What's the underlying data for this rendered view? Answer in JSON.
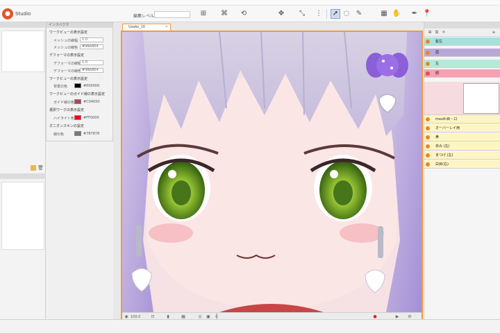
{
  "app": {
    "name": "Studio",
    "edit_level_label": "編集レベル"
  },
  "toolbar": {
    "icons": [
      "undo-icon",
      "redo-icon",
      "deform-icon",
      "warp-icon",
      "rotate-icon",
      "move-icon",
      "select-arrow-icon",
      "lasso-icon",
      "brush-icon",
      "eyedropper-icon",
      "pin-icon"
    ]
  },
  "properties": {
    "header": "インスペクタ",
    "sections": [
      {
        "title": "ワークビューの表示設定",
        "rows": [
          {
            "label": "メッシュの線幅",
            "value": "1.0"
          },
          {
            "label": "メッシュの線色",
            "value": "#9BA8E4"
          }
        ]
      },
      {
        "title": "デフォーマの表示設定",
        "rows": [
          {
            "label": "デフォーマの線幅",
            "value": "1.0"
          },
          {
            "label": "デフォーマの線色",
            "value": "#9BA8E4"
          }
        ]
      },
      {
        "title": "ワークビューの表示設定",
        "rows": [
          {
            "label": "背景の色",
            "value": "#000000",
            "swatch": "#000000"
          }
        ]
      },
      {
        "title": "ワークビューのガイド線の表示設定",
        "rows": [
          {
            "label": "ガイド線の色",
            "value": "#C04050",
            "swatch": "#c04050"
          }
        ]
      },
      {
        "title": "選択ワークの表示設定",
        "rows": [
          {
            "label": "ハイライト色",
            "value": "#FF0000",
            "swatch": "#ff0000"
          }
        ]
      },
      {
        "title": "オニオンスキンの設定",
        "rows": [
          {
            "label": "線の色",
            "value": "#787878",
            "swatch": "#787878"
          }
        ]
      }
    ]
  },
  "view": {
    "tab_label": "Usako_10",
    "zoom": "100.0",
    "status_icons": [
      "camera-icon",
      "fit-icon",
      "grid-icon",
      "ruler-icon",
      "onion-icon",
      "lock-icon",
      "record-icon",
      "play-icon",
      "settings-icon"
    ]
  },
  "layers": {
    "rows": [
      {
        "name": "髪左",
        "bg": "#a6e2dc",
        "eye": "#e08a2a"
      },
      {
        "name": "眉",
        "bg": "#b9a7d9",
        "eye": "#e08a2a"
      },
      {
        "name": "左",
        "bg": "#b3ead8",
        "eye": "#e08a2a"
      },
      {
        "name": "顔",
        "bg": "#f2a3b2",
        "eye": "#e05050"
      },
      {
        "name": "mouth目・口",
        "bg": "#fff5c4",
        "eye": "#e08a2a"
      },
      {
        "name": "オーバーレイ用",
        "bg": "#fff5c4",
        "eye": "#e08a2a"
      },
      {
        "name": "鼻",
        "bg": "#fff5c4",
        "eye": "#e08a2a"
      },
      {
        "name": "赤み (左)",
        "bg": "#fff5c4",
        "eye": "#e08a2a"
      },
      {
        "name": "まつげ (左)",
        "bg": "#fff5c4",
        "eye": "#e08a2a"
      },
      {
        "name": "白目(右)",
        "bg": "#fff5c4",
        "eye": "#e08a2a"
      }
    ]
  }
}
